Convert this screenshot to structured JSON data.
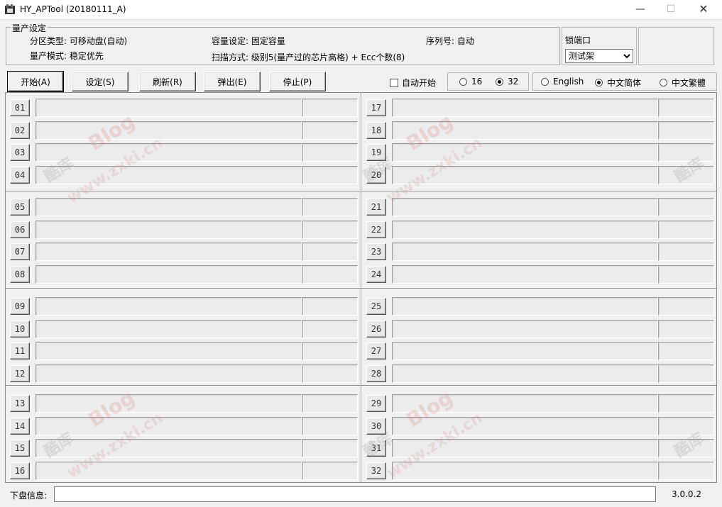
{
  "window": {
    "title": "HY_APTool (20180111_A)",
    "minimize_glyph": "—",
    "maximize_glyph": "☐",
    "close_glyph": "✕"
  },
  "settings": {
    "legend": "量产设定",
    "partition_type": "分区类型: 可移动盘(自动)",
    "capacity": "容量设定: 固定容量",
    "serial": "序列号: 自动",
    "mode": "量产模式: 稳定优先",
    "scan": "扫描方式: 级别5(量产过的芯片高格) + Ecc个数(8)"
  },
  "lock_port": {
    "label": "锁端口",
    "selected": "测试架"
  },
  "toolbar": {
    "start": "开始(A)",
    "setup": "设定(S)",
    "refresh": "刷新(R)",
    "eject": "弹出(E)",
    "stop": "停止(P)"
  },
  "auto_start": {
    "label": "自动开始",
    "checked": false
  },
  "port_count": {
    "opt16": "16",
    "opt32": "32",
    "selected": "32"
  },
  "language": {
    "english": "English",
    "simplified": "中文简体",
    "traditional": "中文繁體",
    "selected": "中文简体"
  },
  "ports": [
    "01",
    "02",
    "03",
    "04",
    "05",
    "06",
    "07",
    "08",
    "09",
    "10",
    "11",
    "12",
    "13",
    "14",
    "15",
    "16",
    "17",
    "18",
    "19",
    "20",
    "21",
    "22",
    "23",
    "24",
    "25",
    "26",
    "27",
    "28",
    "29",
    "30",
    "31",
    "32"
  ],
  "watermark": {
    "cn": "酷库",
    "blog": "Blog",
    "url": "www.zxki.cn"
  },
  "status": {
    "label": "下盘信息:",
    "value": ""
  },
  "version": "3.0.0.2"
}
